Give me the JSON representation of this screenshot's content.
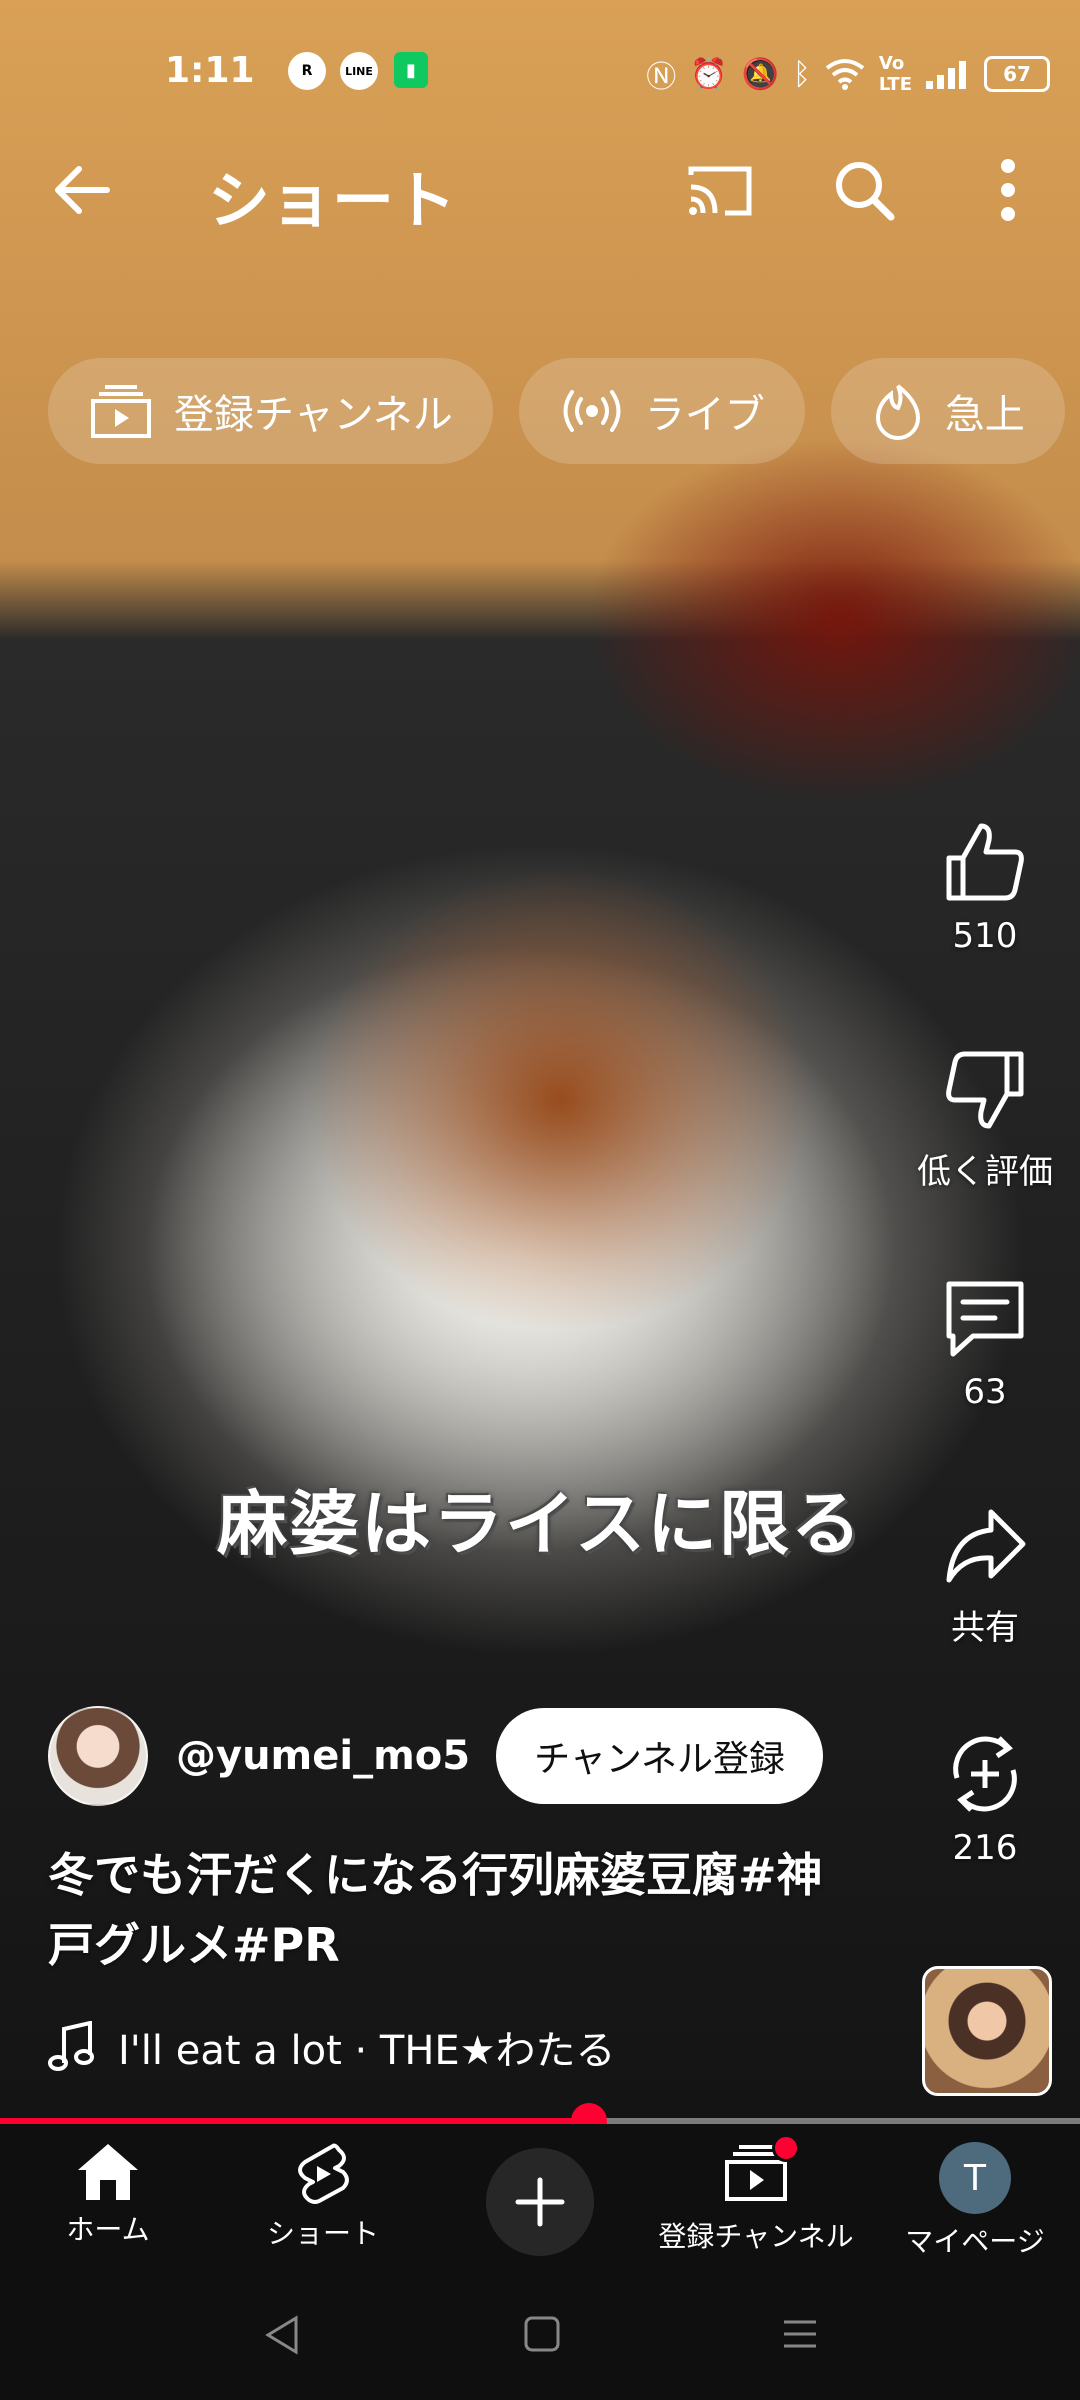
{
  "status_bar": {
    "time": "1:11",
    "app_icons": [
      "R Link",
      "LINE",
      "battery-saver-icon"
    ],
    "r_link_label": "R",
    "line_label": "LINE",
    "system_icons": [
      "nfc-icon",
      "alarm-icon",
      "mute-icon",
      "bluetooth-icon",
      "wifi-icon",
      "volte-icon",
      "signal-icon"
    ],
    "battery": "67"
  },
  "top_bar": {
    "title": "ショート",
    "back_icon": "arrow-left-icon",
    "cast_icon": "cast-icon",
    "search_icon": "search-icon",
    "more_icon": "more-vert-icon"
  },
  "chips": [
    {
      "label": "登録チャンネル",
      "icon": "subscriptions-icon"
    },
    {
      "label": "ライブ",
      "icon": "live-icon"
    },
    {
      "label": "急上",
      "icon": "trending-icon"
    }
  ],
  "video": {
    "caption_overlay": "麻婆はライスに限る",
    "progress_fraction": 0.545
  },
  "actions": {
    "like_count": "510",
    "dislike_label": "低く評価",
    "comment_count": "63",
    "share_label": "共有",
    "remix_count": "216"
  },
  "channel": {
    "handle": "@yumei_mo5",
    "subscribe_label": "チャンネル登録"
  },
  "title": "冬でも汗だくになる行列麻婆豆腐#神戸グルメ#PR",
  "music": {
    "text": "I'll eat a lot · THE★わたる"
  },
  "bottom_nav": {
    "home": "ホーム",
    "shorts": "ショート",
    "subscriptions": "登録チャンネル",
    "mypage": "マイページ",
    "avatar_letter": "T"
  },
  "colors": {
    "accent": "#ff0033",
    "background": "#0f0f0f",
    "chip_bg": "rgba(255,255,255,0.18)"
  }
}
